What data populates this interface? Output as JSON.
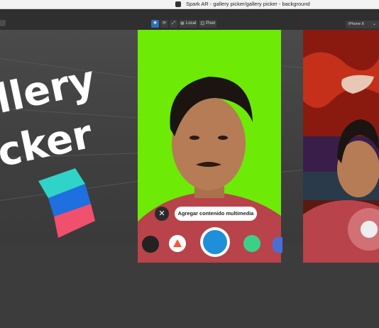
{
  "window": {
    "title": "Spark AR - gallery picker/gallery picker - background"
  },
  "toolbar": {
    "local_label": "Local",
    "pixel_label": "Pixel",
    "device_label": "iPhone 8"
  },
  "scene": {
    "overlay_line1": "llery",
    "overlay_line2": "cker"
  },
  "preview": {
    "tooltip_text": "Agregar contenido multimedia",
    "close_symbol": "✕"
  },
  "colors": {
    "green_screen": "#6dea06",
    "capture_blue": "#1f8fd9",
    "logo_teal": "#2fd3c8",
    "logo_blue": "#1e6fe0",
    "logo_pink": "#f0506e"
  }
}
